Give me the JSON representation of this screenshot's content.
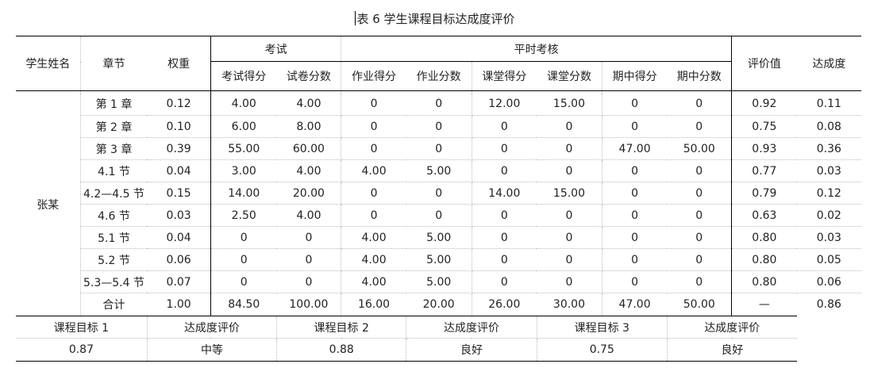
{
  "caption": "表 6   学生课程目标达成度评价",
  "header": {
    "student_name": "学生姓名",
    "chapter": "章节",
    "weight": "权重",
    "exam": "考试",
    "routine": "平时考核",
    "eval_value": "评价值",
    "achievement": "达成度",
    "sub": [
      "考试得分",
      "试卷分数",
      "作业得分",
      "作业分数",
      "课堂得分",
      "课堂分数",
      "期中得分",
      "期中分数"
    ]
  },
  "student": "张某",
  "rows": [
    [
      "第 1 章",
      "0.12",
      "4.00",
      "4.00",
      "0",
      "0",
      "12.00",
      "15.00",
      "0",
      "0",
      "0.92",
      "0.11"
    ],
    [
      "第 2 章",
      "0.10",
      "6.00",
      "8.00",
      "0",
      "0",
      "0",
      "0",
      "0",
      "0",
      "0.75",
      "0.08"
    ],
    [
      "第 3 章",
      "0.39",
      "55.00",
      "60.00",
      "0",
      "0",
      "0",
      "0",
      "47.00",
      "50.00",
      "0.93",
      "0.36"
    ],
    [
      "4.1 节",
      "0.04",
      "3.00",
      "4.00",
      "4.00",
      "5.00",
      "0",
      "0",
      "0",
      "0",
      "0.77",
      "0.03"
    ],
    [
      "4.2—4.5 节",
      "0.15",
      "14.00",
      "20.00",
      "0",
      "0",
      "14.00",
      "15.00",
      "0",
      "0",
      "0.79",
      "0.12"
    ],
    [
      "4.6 节",
      "0.03",
      "2.50",
      "4.00",
      "0",
      "0",
      "0",
      "0",
      "0",
      "0",
      "0.63",
      "0.02"
    ],
    [
      "5.1 节",
      "0.04",
      "0",
      "0",
      "4.00",
      "5.00",
      "0",
      "0",
      "0",
      "0",
      "0.80",
      "0.03"
    ],
    [
      "5.2 节",
      "0.06",
      "0",
      "0",
      "4.00",
      "5.00",
      "0",
      "0",
      "0",
      "0",
      "0.80",
      "0.05"
    ],
    [
      "5.3—5.4 节",
      "0.07",
      "0",
      "0",
      "4.00",
      "5.00",
      "0",
      "0",
      "0",
      "0",
      "0.80",
      "0.06"
    ]
  ],
  "total": [
    "合计",
    "1.00",
    "84.50",
    "100.00",
    "16.00",
    "20.00",
    "26.00",
    "30.00",
    "47.00",
    "50.00",
    "—",
    "0.86"
  ],
  "summary": {
    "labels": [
      "课程目标 1",
      "达成度评价",
      "课程目标 2",
      "达成度评价",
      "课程目标 3",
      "达成度评价"
    ],
    "values": [
      "0.87",
      "中等",
      "0.88",
      "良好",
      "0.75",
      "良好"
    ]
  }
}
